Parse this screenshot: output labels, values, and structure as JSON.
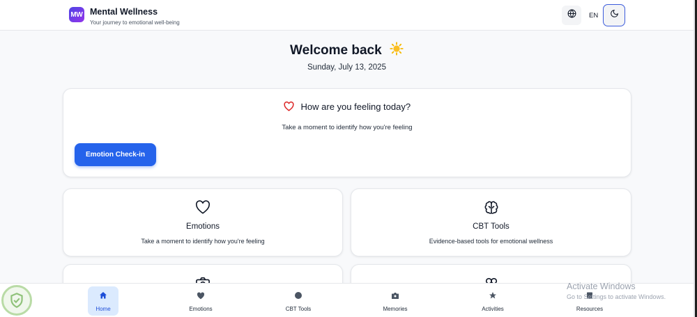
{
  "header": {
    "logo_text": "MW",
    "title": "Mental Wellness",
    "subtitle": "Your journey to emotional well-being",
    "language": "EN",
    "icons": {
      "language": "globe-icon",
      "theme": "moon-icon"
    }
  },
  "welcome": {
    "title": "Welcome back",
    "date": "Sunday, July 13, 2025"
  },
  "checkin": {
    "title": "How are you feeling today?",
    "description": "Take a moment to identify how you're feeling",
    "button_label": "Emotion Check-in"
  },
  "features": [
    {
      "title": "Emotions",
      "description": "Take a moment to identify how you're feeling",
      "icon": "heart-icon"
    },
    {
      "title": "CBT Tools",
      "description": "Evidence-based tools for emotional wellness",
      "icon": "brain-icon"
    },
    {
      "icon": "camera-icon"
    },
    {
      "icon": "infinity-icon"
    }
  ],
  "bottom_nav": [
    {
      "label": "Home",
      "icon": "home-icon",
      "active": true
    },
    {
      "label": "Emotions",
      "icon": "heart-icon"
    },
    {
      "label": "CBT Tools",
      "icon": "brain-icon"
    },
    {
      "label": "Memories",
      "icon": "camera-icon"
    },
    {
      "label": "Activities",
      "icon": "star-icon"
    },
    {
      "label": "Resources",
      "icon": "book-icon"
    }
  ],
  "watermark": {
    "title": "Activate Windows",
    "subtitle": "Go to Settings to activate Windows."
  },
  "colors": {
    "primary": "#2563eb",
    "heart_accent": "#dc2626",
    "background": "#f8f9fb",
    "active_nav_bg": "#dbeafe"
  }
}
